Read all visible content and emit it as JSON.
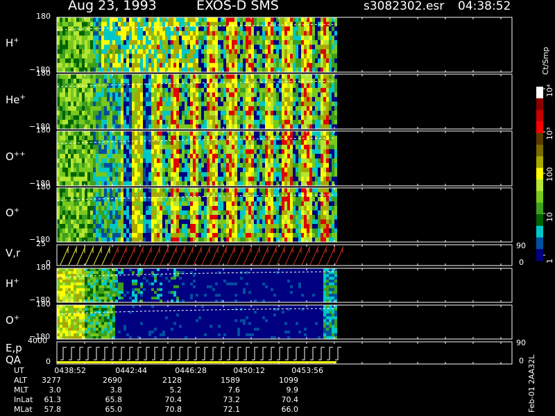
{
  "header": {
    "date": "Aug 23, 1993",
    "instrument": "EXOS-D SMS",
    "file": "s3082302.esr",
    "time": "04:38:52"
  },
  "panels": [
    {
      "label": "H",
      "sup": "+",
      "top_tick": "180",
      "bottom_tick": "−180"
    },
    {
      "label": "He",
      "sup": "+",
      "top_tick": "180",
      "bottom_tick": "−180"
    },
    {
      "label": "O",
      "sup": "++",
      "top_tick": "180",
      "bottom_tick": "−180"
    },
    {
      "label": "O",
      "sup": "+",
      "top_tick": "180",
      "bottom_tick": "−180"
    },
    {
      "label": "V,r",
      "sup": "",
      "top_tick": "25",
      "bottom_tick": "0",
      "right_top": "90",
      "right_bottom": "0"
    },
    {
      "label": "H",
      "sup": "+",
      "top_tick": "180",
      "bottom_tick": "−180"
    },
    {
      "label": "O",
      "sup": "+",
      "top_tick": "180",
      "bottom_tick": "−180"
    },
    {
      "label": "E,p",
      "sup": "",
      "label2": "QA",
      "top_tick": "4000",
      "bottom_tick": "0",
      "right_top": "90",
      "right_bottom": "0"
    }
  ],
  "colorbar": {
    "unit": "Ct/Smp",
    "ticks": [
      "10⁴",
      "10³",
      "100",
      "10",
      "1"
    ],
    "colors": [
      "#ffffff",
      "#8b0000",
      "#c80000",
      "#ff0000",
      "#5a3c00",
      "#7a6a00",
      "#a8a800",
      "#ffff00",
      "#b4e632",
      "#78c81e",
      "#3ca01e",
      "#006400",
      "#00c8c8",
      "#0050a0",
      "#000080"
    ]
  },
  "ut_table": {
    "rows": [
      {
        "name": "UT",
        "values": [
          "0438:52",
          "0442:44",
          "0446:28",
          "0450:12",
          "0453:56"
        ]
      },
      {
        "name": "ALT",
        "values": [
          "3277",
          "2690",
          "2128",
          "1589",
          "1099"
        ]
      },
      {
        "name": "MLT",
        "values": [
          "3.0",
          "3.8",
          "5.2",
          "7.6",
          "9.9"
        ]
      },
      {
        "name": "InLat",
        "values": [
          "61.3",
          "65.8",
          "70.4",
          "73.2",
          "70.4"
        ]
      },
      {
        "name": "MLat",
        "values": [
          "57.8",
          "65.0",
          "70.8",
          "72.1",
          "66.0"
        ]
      }
    ]
  },
  "side_code": "Feb-01 2AA32L",
  "chart_data": {
    "type": "heatmap",
    "title": "Aug 23, 1993   EXOS-D SMS",
    "x_ticks_ut": [
      "0438:52",
      "0442:44",
      "0446:28",
      "0450:12",
      "0453:56"
    ],
    "panels": [
      {
        "name": "H+",
        "ylim": [
          -180,
          180
        ]
      },
      {
        "name": "He+",
        "ylim": [
          -180,
          180
        ]
      },
      {
        "name": "O++",
        "ylim": [
          -180,
          180
        ]
      },
      {
        "name": "O+",
        "ylim": [
          -180,
          180
        ]
      },
      {
        "name": "V,r",
        "ylim": [
          0,
          25
        ],
        "right_ylim": [
          0,
          90
        ]
      },
      {
        "name": "H+",
        "ylim": [
          -180,
          180
        ]
      },
      {
        "name": "O+",
        "ylim": [
          -180,
          180
        ]
      },
      {
        "name": "E,p QA",
        "ylim": [
          0,
          4000
        ],
        "right_ylim": [
          0,
          90
        ]
      }
    ],
    "colorbar_scale": "log",
    "colorbar_range": [
      1,
      10000
    ],
    "colorbar_unit": "Ct/Smp"
  }
}
